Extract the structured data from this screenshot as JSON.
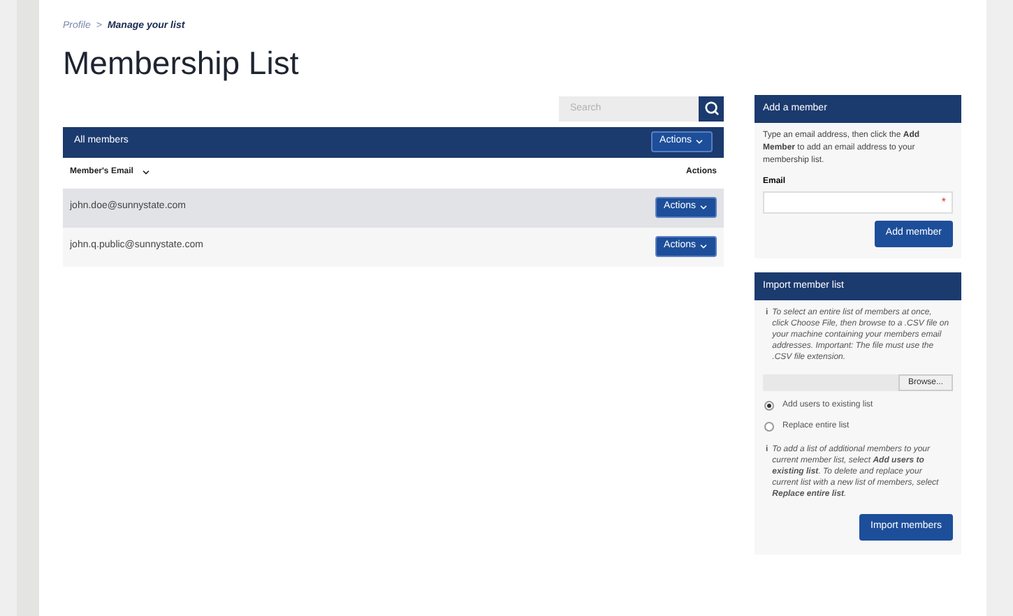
{
  "breadcrumb": {
    "parent": "Profile",
    "separator": ">",
    "current": "Manage your list"
  },
  "title": "Membership List",
  "search": {
    "placeholder": "Search"
  },
  "table": {
    "title": "All members",
    "header_action": "Actions",
    "columns": [
      "Member's Email",
      "Actions"
    ],
    "rows": [
      {
        "email": "john.doe@sunnystate.com",
        "action": "Actions",
        "selected": true
      },
      {
        "email": "john.q.public@sunnystate.com",
        "action": "Actions",
        "selected": false
      }
    ]
  },
  "add_member": {
    "title": "Add a member",
    "help": "Type an email address, then click the **Add Member** to add an email address to your membership list.",
    "email_label": "Email",
    "required_mark": "*",
    "button": "Add member"
  },
  "import": {
    "title": "Import member list",
    "info_icon": "i",
    "info": "To select an entire list of members at once, click Choose File, then browse to a .CSV file on your machine containing your members email addresses. Important: The file must use the .CSV file extension.",
    "browse": "Browse...",
    "options": [
      {
        "label": "Add users to existing list",
        "selected": true
      },
      {
        "label": "Replace entire list",
        "selected": false
      }
    ],
    "info2_icon": "i",
    "info2": "To add a list of additional members to your current member list, select **Add users to existing list**. To delete and replace your current list with a new list of members, select **Replace entire list**.",
    "button": "Import members"
  }
}
